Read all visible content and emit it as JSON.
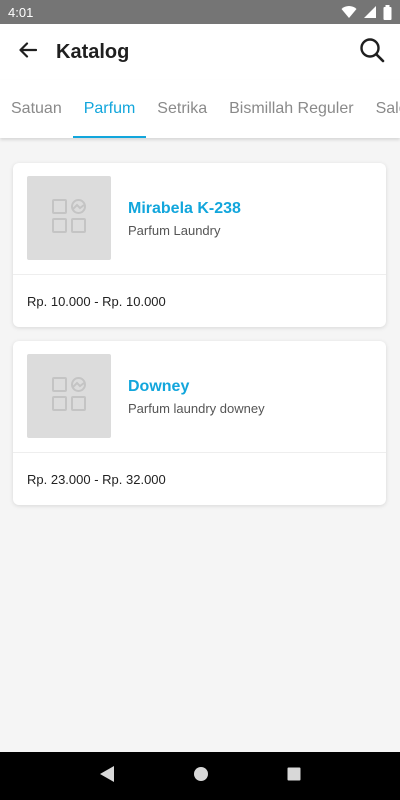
{
  "status_bar": {
    "time": "4:01",
    "icons": [
      "wifi-icon",
      "signal-icon",
      "battery-icon"
    ]
  },
  "app_bar": {
    "title": "Katalog",
    "back_icon": "arrow-left-icon",
    "search_icon": "search-icon"
  },
  "tabs": [
    {
      "label": "Satuan",
      "active": false
    },
    {
      "label": "Parfum",
      "active": true
    },
    {
      "label": "Setrika",
      "active": false
    },
    {
      "label": "Bismillah Reguler",
      "active": false
    },
    {
      "label": "Salon",
      "active": false
    }
  ],
  "products": [
    {
      "name": "Mirabela K-238",
      "description": "Parfum Laundry",
      "price": "Rp. 10.000 - Rp. 10.000",
      "image_icon": "image-placeholder-icon"
    },
    {
      "name": "Downey",
      "description": "Parfum laundry downey",
      "price": "Rp. 23.000 - Rp. 32.000",
      "image_icon": "image-placeholder-icon"
    }
  ],
  "colors": {
    "accent": "#12a6dc",
    "status_bar": "#757575",
    "background": "#f5f5f5"
  },
  "nav_bar": {
    "icons": [
      "back-triangle-icon",
      "home-circle-icon",
      "recents-square-icon"
    ]
  }
}
